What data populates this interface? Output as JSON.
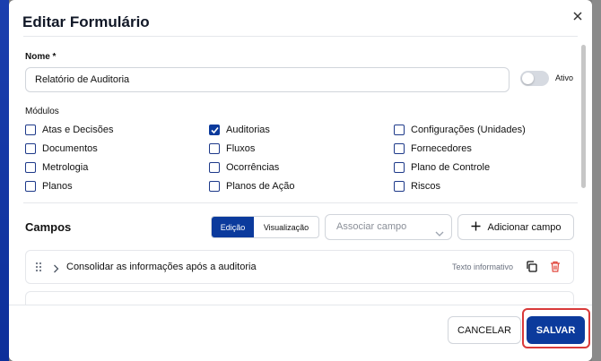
{
  "dialog": {
    "title": "Editar Formulário"
  },
  "form": {
    "name_label": "Nome *",
    "name_value": "Relatório de Auditoria",
    "active_label": "Ativo",
    "modules_label": "Módulos",
    "modules": [
      {
        "label": "Atas e Decisões",
        "checked": false
      },
      {
        "label": "Auditorias",
        "checked": true
      },
      {
        "label": "Configurações (Unidades)",
        "checked": false
      },
      {
        "label": "Documentos",
        "checked": false
      },
      {
        "label": "Fluxos",
        "checked": false
      },
      {
        "label": "Fornecedores",
        "checked": false
      },
      {
        "label": "Metrologia",
        "checked": false
      },
      {
        "label": "Ocorrências",
        "checked": false
      },
      {
        "label": "Plano de Controle",
        "checked": false
      },
      {
        "label": "Planos",
        "checked": false
      },
      {
        "label": "Planos de Ação",
        "checked": false
      },
      {
        "label": "Riscos",
        "checked": false
      }
    ]
  },
  "campos": {
    "title": "Campos",
    "tab_edit": "Edição",
    "tab_view": "Visualização",
    "select_placeholder": "Associar campo",
    "add_label": "Adicionar campo",
    "fields": [
      {
        "title": "Consolidar as informações após a auditoria",
        "type": "Texto informativo"
      }
    ]
  },
  "footer": {
    "cancel_label": "CANCELAR",
    "save_label": "SALVAR"
  },
  "colors": {
    "primary": "#0b3a9c",
    "highlight": "#d93a3a"
  }
}
